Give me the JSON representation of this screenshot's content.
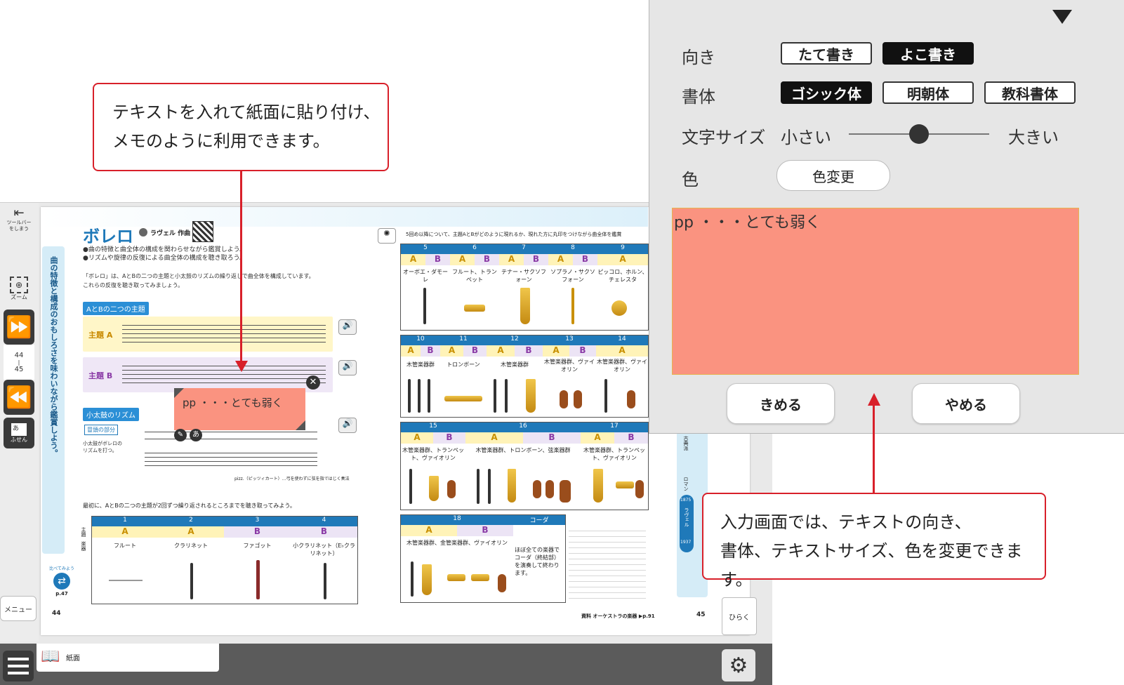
{
  "callouts": {
    "top_line1": "テキストを入れて紙面に貼り付け、",
    "top_line2": "メモのように利用できます。",
    "bottom_line1": "入力画面では、テキストの向き、",
    "bottom_line2": "書体、テキストサイズ、色を変更できます。"
  },
  "toolbar": {
    "hide_label": "ツールバーをしまう",
    "zoom_label": "ズーム",
    "page_top": "44",
    "page_bottom": "45",
    "sticky_glyph": "あ",
    "sticky_label": "ふせん",
    "menu_label": "メニュー",
    "open_label": "ひらく"
  },
  "bottom_bar": {
    "view_label": "紙面"
  },
  "page_left": {
    "title": "ボレロ",
    "composer": "ラヴェル 作曲",
    "goal1": "●曲の特徴と曲全体の構成を関わらせながら鑑賞しよう。",
    "goal2": "●リズムや旋律の反復による曲全体の構成を聴き取ろう。",
    "vertical_heading": "曲の特徴と構成のおもしろさを味わいながら鑑賞しよう。",
    "intro1": "「ボレロ」は、AとBの二つの主題と小太鼓のリズムの繰り返しで曲全体を構成しています。",
    "intro2": "これらの反復を聴き取ってみましょう。",
    "section_themes": "AとBの二つの主題",
    "theme_a": "主題 A",
    "theme_b": "主題 B",
    "section_drum": "小太鼓のリズム",
    "sub_note": "冒頭の部分",
    "drum_note": "小太鼓がボレロのリズムを打つ。",
    "pizz_note": "pizz.（ピッツィカート）…弓を使わずに弦を指ではじく奏法",
    "instruction": "最初に、AとBの二つの主題が2回ずつ繰り返されるところまでを聴き取ってみよう。",
    "compare_label": "比べてみよう",
    "compare_ref": "p.47",
    "page_number": "44",
    "table": {
      "numbers": [
        "1",
        "2",
        "3",
        "4"
      ],
      "themes": [
        "A",
        "A",
        "B",
        "B"
      ],
      "instruments": [
        "フルート",
        "クラリネット",
        "ファゴット",
        "小クラリネット（E♭クラリネット）"
      ],
      "row_labels": [
        "主題",
        "楽器"
      ]
    }
  },
  "sticky_note": {
    "text": "pp ・・・とても弱く"
  },
  "page_right": {
    "instruction": "5回め以降について、主題AとBがどのように現れるか、現れた方に丸印をつけながら曲全体を鑑賞",
    "page_number": "45",
    "footer_ref": "資料 オーケストラの楽器 ▶p.91",
    "row1": [
      {
        "n": "5",
        "inst": "オーボエ・ダモーレ"
      },
      {
        "n": "6",
        "inst": "フルート、トランペット"
      },
      {
        "n": "7",
        "inst": "テナー・サクソフォーン"
      },
      {
        "n": "8",
        "inst": "ソプラノ・サクソフォーン"
      },
      {
        "n": "9",
        "inst": "ピッコロ、ホルン、チェレスタ"
      }
    ],
    "row2": [
      {
        "n": "10",
        "inst": "木管楽器群"
      },
      {
        "n": "11",
        "inst": "トロンボーン"
      },
      {
        "n": "12",
        "inst": "木管楽器群"
      },
      {
        "n": "13",
        "inst": "木管楽器群、ヴァイオリン"
      },
      {
        "n": "14",
        "inst": "木管楽器群、ヴァイオリン"
      }
    ],
    "row3": [
      {
        "n": "15",
        "inst": "木管楽器群、トランペット、ヴァイオリン"
      },
      {
        "n": "16",
        "inst": "木管楽器群、トロンボーン、弦楽器群"
      },
      {
        "n": "17",
        "inst": "木管楽器群、トランペット、ヴァイオリン"
      }
    ],
    "row4": {
      "n": "18",
      "coda": "コーダ",
      "inst": "木管楽器群、金管楽器群、ヴァイオリン",
      "coda_text": "ほぼ全ての楽器でコーダ（終結部）を演奏して終わります。"
    },
    "timeline": [
      "古典派",
      "ロマン",
      "ラヴェル",
      "1875",
      "1937"
    ]
  },
  "settings": {
    "orientation_label": "向き",
    "orientation_options": [
      "たて書き",
      "よこ書き"
    ],
    "orientation_selected": "よこ書き",
    "font_label": "書体",
    "font_options": [
      "ゴシック体",
      "明朝体",
      "教科書体"
    ],
    "font_selected": "ゴシック体",
    "size_label": "文字サイズ",
    "size_small": "小さい",
    "size_large": "大きい",
    "size_level": 0.5,
    "color_label": "色",
    "color_button": "色変更",
    "note_color": "#fa9380",
    "text_value": "pp ・・・とても弱く",
    "ok_button": "きめる",
    "cancel_button": "やめる"
  },
  "colors": {
    "callout_red": "#d8202a",
    "theme_a_bg": "#fff6c8",
    "theme_b_bg": "#efe7f6",
    "header_blue": "#1f79b9"
  }
}
